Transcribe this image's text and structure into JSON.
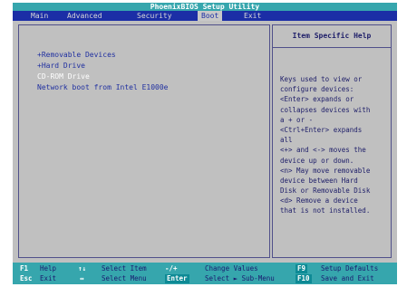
{
  "title": "PhoenixBIOS Setup Utility",
  "menu": [
    {
      "label": "Main",
      "active": false
    },
    {
      "label": "Advanced",
      "active": false
    },
    {
      "label": "Security",
      "active": false
    },
    {
      "label": "Boot",
      "active": true
    },
    {
      "label": "Exit",
      "active": false
    }
  ],
  "boot_list": [
    {
      "label": "+Removable Devices",
      "selected": false
    },
    {
      "label": "+Hard Drive",
      "selected": false
    },
    {
      "label": " CD-ROM Drive",
      "selected": true
    },
    {
      "label": " Network boot from Intel E1000e",
      "selected": false
    }
  ],
  "help": {
    "title": "Item Specific Help",
    "lines": [
      "Keys used to view or",
      "configure devices:",
      "<Enter> expands or",
      "collapses devices with",
      "a + or -",
      "<Ctrl+Enter> expands",
      "all",
      "<+> and <-> moves the",
      "device up or down.",
      "<n> May move removable",
      "device between Hard",
      "Disk or Removable Disk",
      "<d> Remove a device",
      "that is not installed."
    ]
  },
  "footer": {
    "row1": [
      {
        "key": "F1",
        "label": "Help"
      },
      {
        "key": "↑↓",
        "label": "Select Item"
      },
      {
        "key": "-/+",
        "label": "Change Values"
      },
      {
        "key": "F9",
        "label": "Setup Defaults"
      }
    ],
    "row2": [
      {
        "key": "Esc",
        "label": "Exit"
      },
      {
        "key": "↔",
        "label": "Select Menu"
      },
      {
        "key": "Enter",
        "label": "Select ► Sub-Menu"
      },
      {
        "key": "F10",
        "label": "Save and Exit"
      }
    ]
  }
}
